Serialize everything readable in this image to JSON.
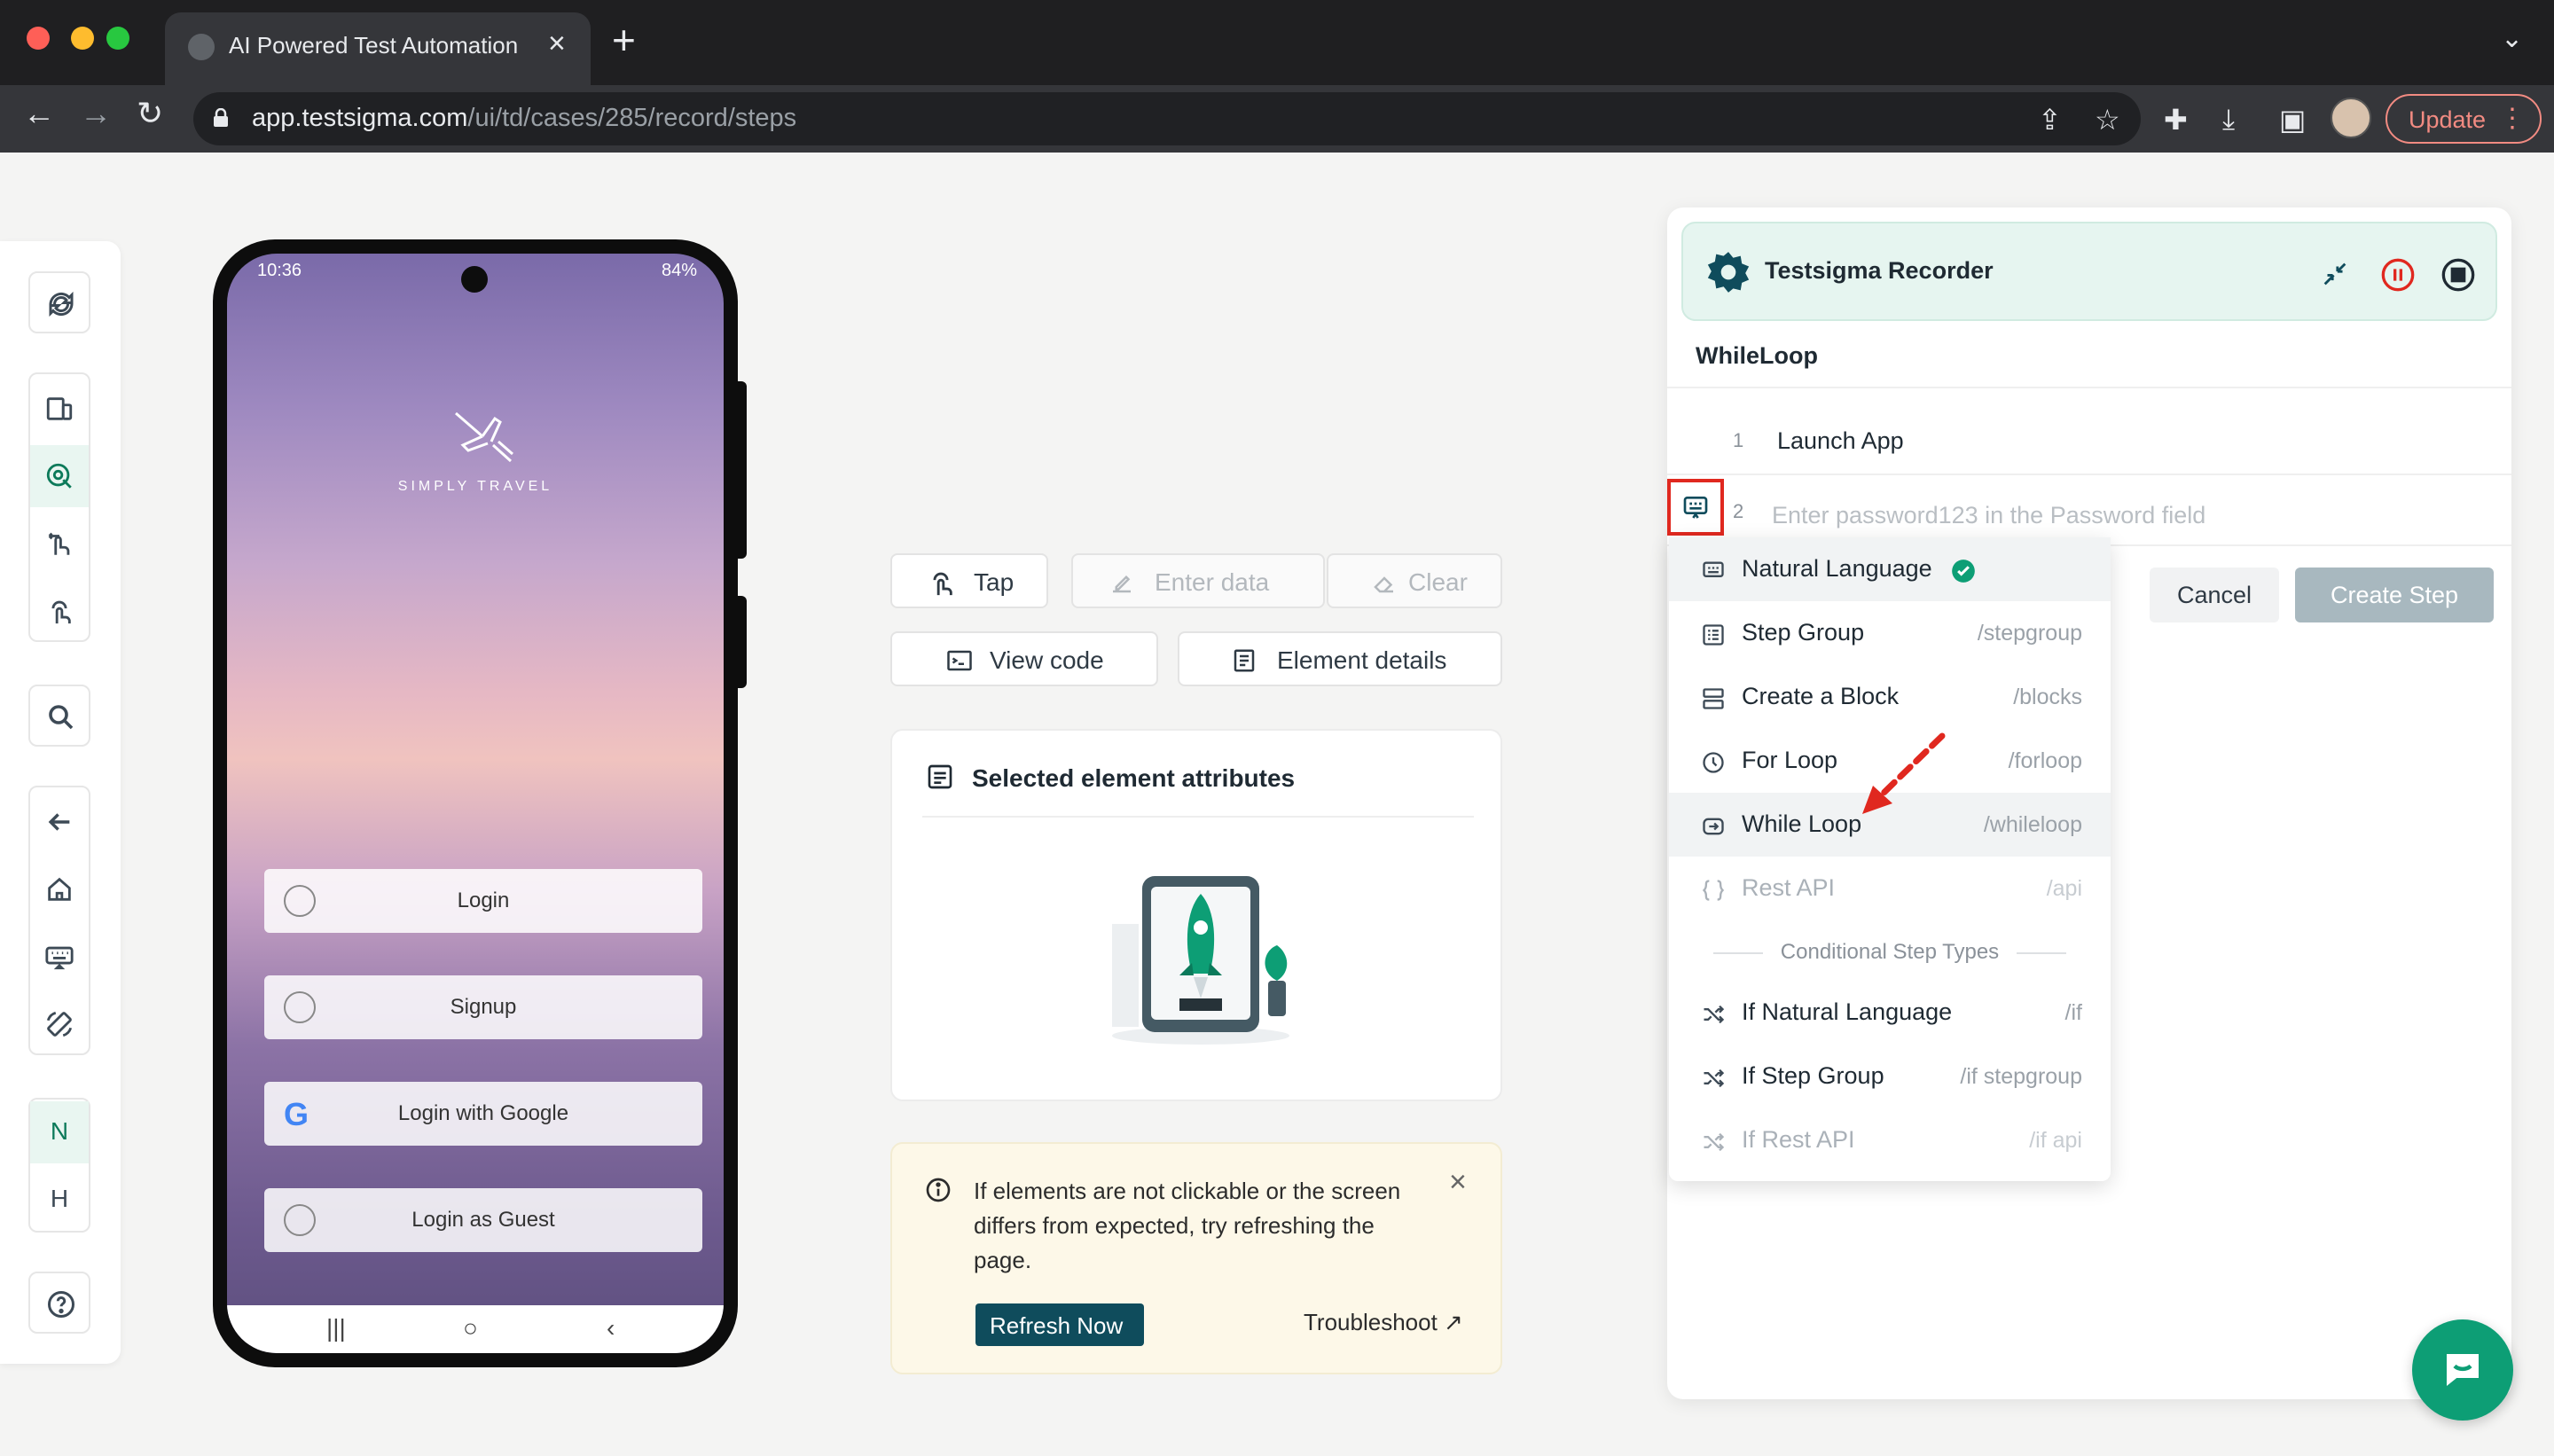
{
  "browser": {
    "tab_title": "AI Powered Test Automation Pl",
    "new_tab": "+",
    "url_host": "app.testsigma.com",
    "url_path": "/ui/td/cases/285/record/steps",
    "update_label": "Update"
  },
  "phone": {
    "time": "10:36",
    "battery": "84%",
    "brand": "SIMPLY TRAVEL",
    "buttons": [
      "Login",
      "Signup",
      "Login with Google",
      "Login as Guest"
    ],
    "nav": [
      "|||",
      "○",
      "‹"
    ]
  },
  "rail": {
    "text_items": [
      "N",
      "H"
    ]
  },
  "actions": {
    "tap": "Tap",
    "enter_data": "Enter data",
    "clear": "Clear",
    "view_code": "View code",
    "element_details": "Element details"
  },
  "attributes": {
    "title": "Selected element attributes"
  },
  "info": {
    "message": "If elements are not clickable or the screen differs from expected, try refreshing the page.",
    "refresh": "Refresh Now",
    "troubleshoot": "Troubleshoot"
  },
  "recorder": {
    "title": "Testsigma Recorder",
    "case_name": "WhileLoop",
    "steps": [
      {
        "num": "1",
        "text": "Launch App"
      },
      {
        "num": "2",
        "placeholder": "Enter password123 in the Password field"
      }
    ],
    "cancel": "Cancel",
    "create": "Create Step"
  },
  "dropdown": {
    "items": [
      {
        "label": "Natural Language",
        "shortcut": "",
        "icon": "natural-language-icon"
      },
      {
        "label": "Step Group",
        "shortcut": "/stepgroup",
        "icon": "step-group-icon"
      },
      {
        "label": "Create a Block",
        "shortcut": "/blocks",
        "icon": "block-icon"
      },
      {
        "label": "For Loop",
        "shortcut": "/forloop",
        "icon": "for-loop-icon"
      },
      {
        "label": "While Loop",
        "shortcut": "/whileloop",
        "icon": "while-loop-icon"
      },
      {
        "label": "Rest API",
        "shortcut": "/api",
        "icon": "api-icon"
      }
    ],
    "divider": "Conditional Step Types",
    "conditional": [
      {
        "label": "If Natural Language",
        "shortcut": "/if",
        "icon": "shuffle-icon"
      },
      {
        "label": "If Step Group",
        "shortcut": "/if stepgroup",
        "icon": "shuffle-icon"
      },
      {
        "label": "If Rest API",
        "shortcut": "/if api",
        "icon": "shuffle-icon"
      }
    ]
  },
  "colors": {
    "brand_green": "#0d9e75",
    "annotation_red": "#e0281f"
  }
}
